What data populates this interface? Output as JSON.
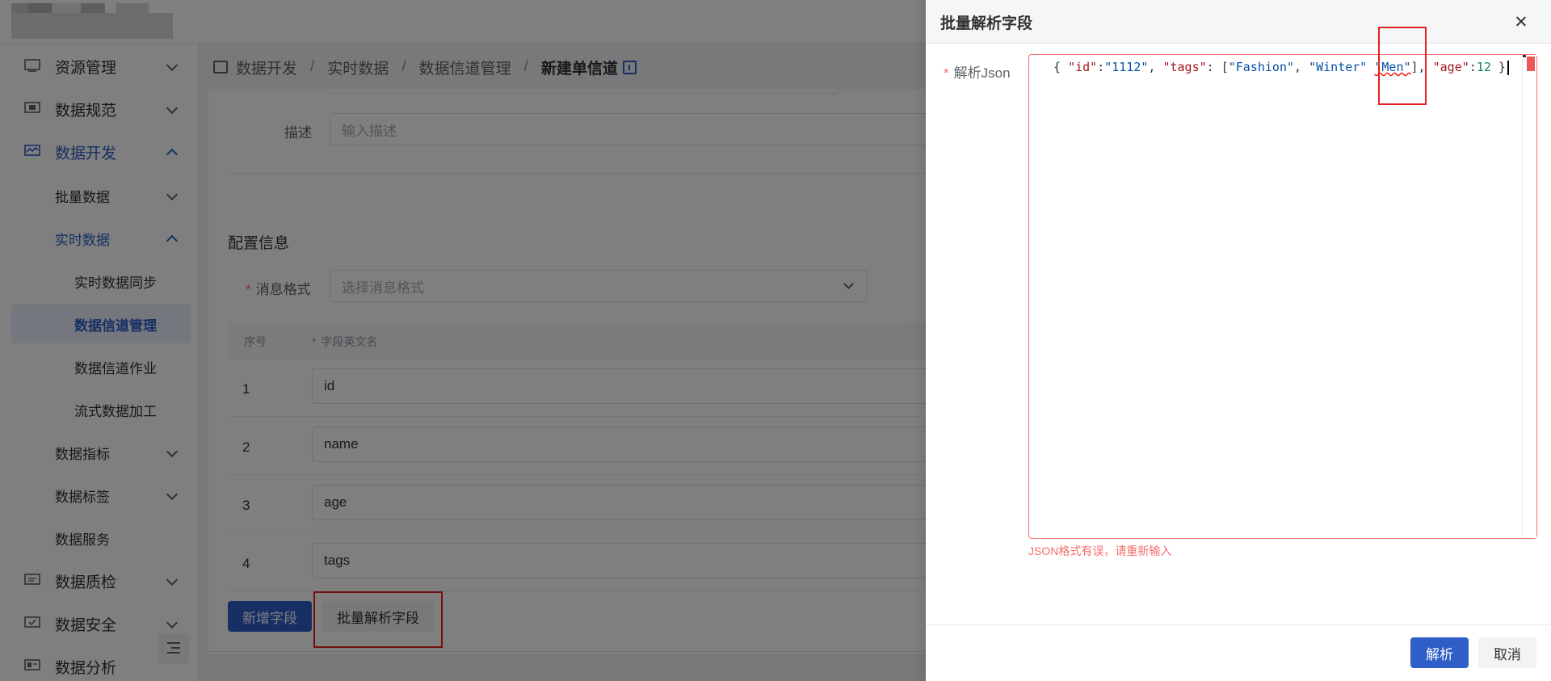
{
  "sidebar": {
    "items": [
      {
        "label": "资源管理"
      },
      {
        "label": "数据规范"
      },
      {
        "label": "数据开发"
      },
      {
        "label": "批量数据"
      },
      {
        "label": "实时数据"
      },
      {
        "label": "实时数据同步"
      },
      {
        "label": "数据信道管理"
      },
      {
        "label": "数据信道作业"
      },
      {
        "label": "流式数据加工"
      },
      {
        "label": "数据指标"
      },
      {
        "label": "数据标签"
      },
      {
        "label": "数据服务"
      },
      {
        "label": "数据质检"
      },
      {
        "label": "数据安全"
      },
      {
        "label": "数据分析"
      }
    ]
  },
  "breadcrumb": {
    "items": [
      "数据开发",
      "实时数据",
      "数据信道管理"
    ],
    "current": "新建单信道",
    "separator": "/"
  },
  "form": {
    "desc_label": "描述",
    "desc_placeholder": "输入描述",
    "section_title": "配置信息",
    "format_label": "消息格式",
    "format_placeholder": "选择消息格式",
    "required_mark": "*"
  },
  "table": {
    "col_index": "序号",
    "col_name": "字段英文名",
    "rows": [
      {
        "index": "1",
        "name": "id"
      },
      {
        "index": "2",
        "name": "name"
      },
      {
        "index": "3",
        "name": "age"
      },
      {
        "index": "4",
        "name": "tags"
      }
    ]
  },
  "actions": {
    "add_field": "新增字段",
    "batch_parse": "批量解析字段"
  },
  "drawer": {
    "title": "批量解析字段",
    "json_label": "解析Json",
    "json_error": "JSON格式有误，请重新输入",
    "parse_button": "解析",
    "cancel_button": "取消",
    "code": {
      "open": "{ ",
      "k1": "\"id\"",
      "v1": "\"1112\"",
      "k2": "\"tags\"",
      "t1": "\"Fashion\"",
      "t2": "\"Winter\"",
      "t3": "\"Men\"",
      "k3": "\"age\"",
      "v3": "12",
      "close": " }"
    }
  },
  "colors": {
    "primary": "#2f5ec8",
    "error": "#f56c6c",
    "highlight_box": "#e81f1f"
  }
}
